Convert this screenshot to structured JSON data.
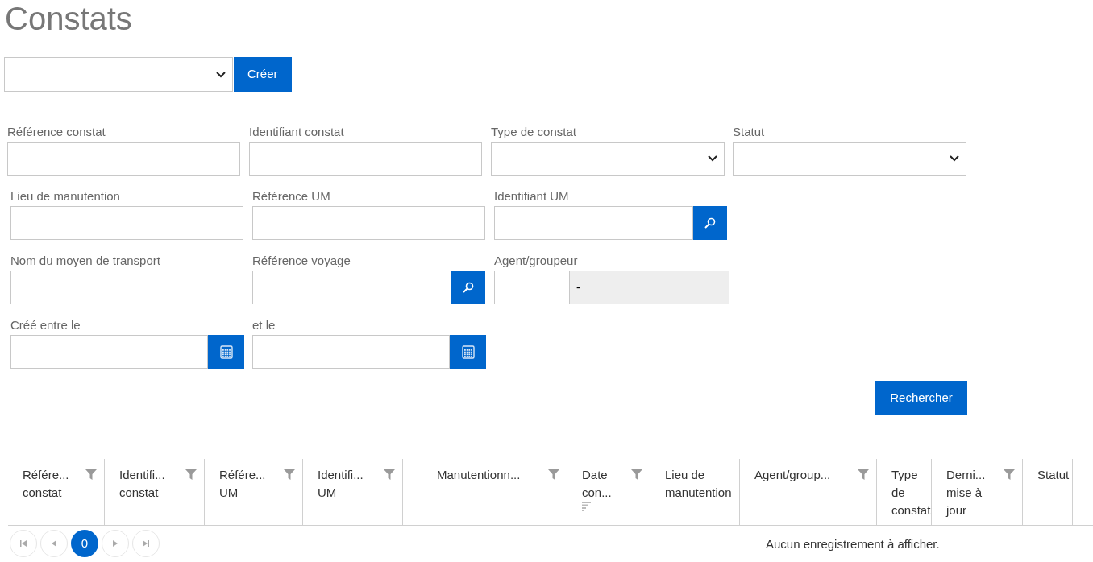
{
  "title": "Constats",
  "create": {
    "button": "Créer"
  },
  "form_rows": [
    [
      {
        "label": "Référence constat",
        "kind": "text"
      },
      {
        "label": "Identifiant constat",
        "kind": "text"
      },
      {
        "label": "Type de constat",
        "kind": "select"
      },
      {
        "label": "Statut",
        "kind": "select"
      }
    ],
    [
      {
        "label": "Lieu de manutention",
        "kind": "text"
      },
      {
        "label": "Référence UM",
        "kind": "text"
      },
      {
        "label": "Identifiant UM",
        "kind": "search"
      }
    ],
    [
      {
        "label": "Nom du moyen de transport",
        "kind": "text"
      },
      {
        "label": "Référence voyage",
        "kind": "search"
      },
      {
        "label": "Agent/groupeur",
        "kind": "agent",
        "display": "-"
      }
    ],
    [
      {
        "label": "Créé entre le",
        "kind": "date"
      },
      {
        "label": "et le",
        "kind": "date"
      }
    ]
  ],
  "search_button": "Rechercher",
  "table": {
    "columns": [
      {
        "kind": "column",
        "label": "Référe... constat",
        "filter": true,
        "sort": false
      },
      {
        "kind": "column",
        "label": "Identifi... constat",
        "filter": true,
        "sort": false
      },
      {
        "kind": "column",
        "label": "Référe... UM",
        "filter": true,
        "sort": false
      },
      {
        "kind": "column",
        "label": "Identifi... UM",
        "filter": true,
        "sort": false
      },
      {
        "kind": "blank"
      },
      {
        "kind": "column",
        "label": "Manutentionn...",
        "filter": true,
        "sort": false
      },
      {
        "kind": "column",
        "label": "Date con...",
        "filter": true,
        "sort": true
      },
      {
        "kind": "column",
        "label": "Lieu de manutention",
        "filter": false,
        "sort": false
      },
      {
        "kind": "column",
        "label": "Agent/group...",
        "filter": true,
        "sort": false
      },
      {
        "kind": "column",
        "label": "Type de constat",
        "filter": false,
        "sort": false
      },
      {
        "kind": "column",
        "label": "Derni... mise à jour",
        "filter": true,
        "sort": false
      },
      {
        "kind": "column",
        "label": "Statut",
        "filter": false,
        "sort": false
      }
    ],
    "pages": [
      {
        "label": "0",
        "selected": true
      }
    ],
    "empty_message": "Aucun enregistrement à afficher."
  }
}
